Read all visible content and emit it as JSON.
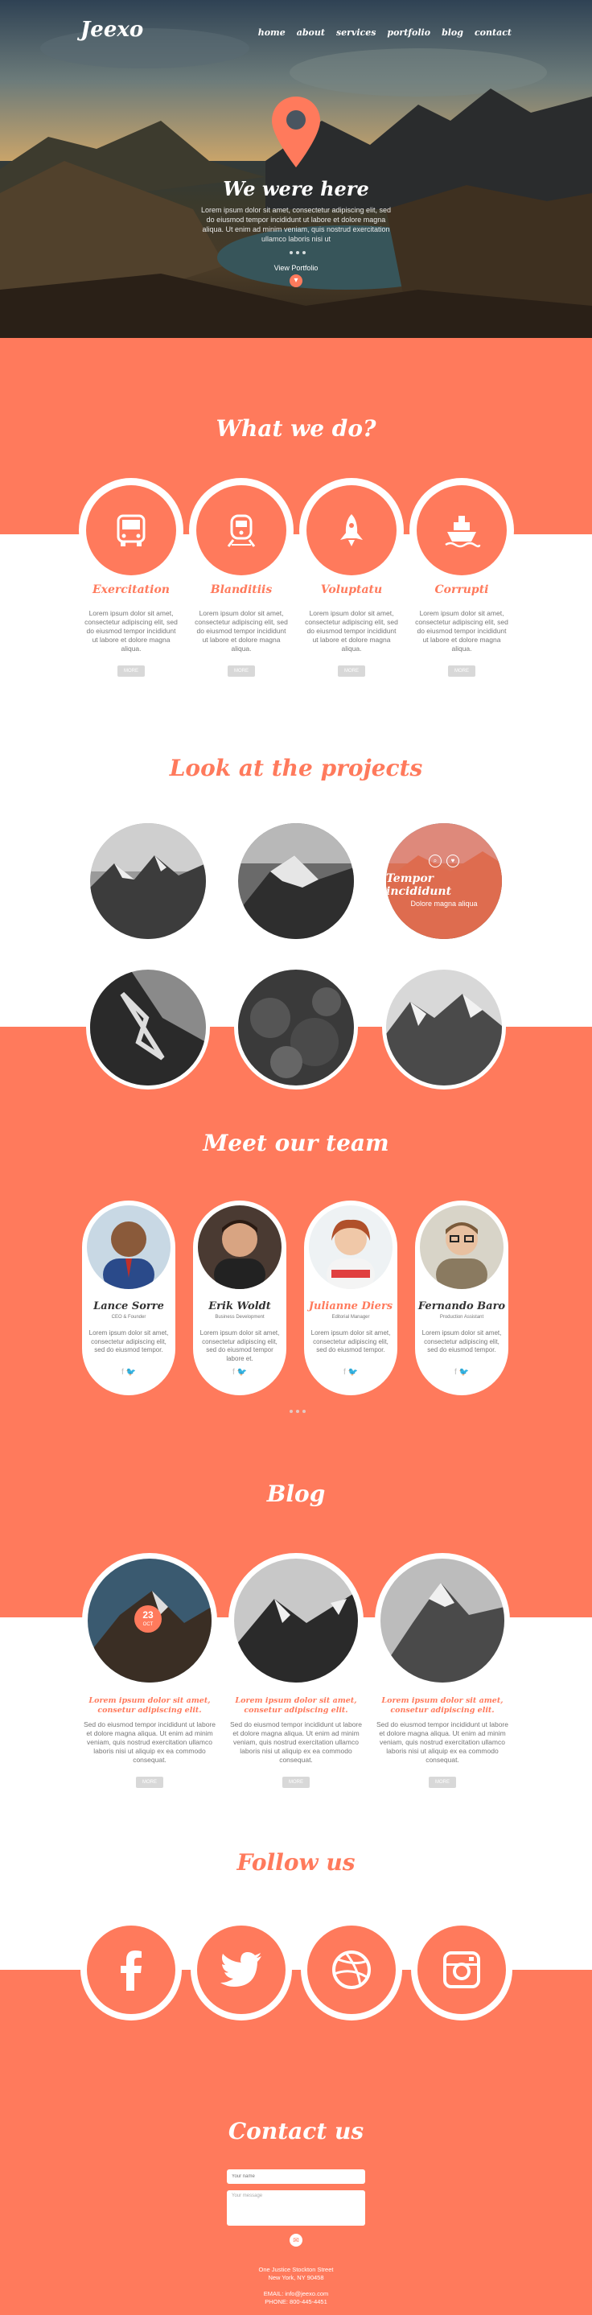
{
  "brand": {
    "logo": "Jeexo"
  },
  "nav": {
    "items": [
      "home",
      "about",
      "services",
      "portfolio",
      "blog",
      "contact"
    ]
  },
  "hero": {
    "title": "We were here",
    "text": "Lorem ipsum dolor sit amet, consectetur adipiscing elit, sed do eiusmod tempor incididunt ut labore et dolore magna aliqua. Ut enim ad minim veniam, quis nostrud exercitation ullamco laboris nisi ut",
    "link": "View Portfolio"
  },
  "services": {
    "title": "What we do?",
    "more_label": "MORE",
    "items": [
      {
        "icon": "bus-icon",
        "title": "Exercitation",
        "text": "Lorem ipsum dolor sit amet, consectetur adipiscing elit, sed do eiusmod tempor incididunt ut labore et dolore magna aliqua."
      },
      {
        "icon": "train-icon",
        "title": "Blanditiis",
        "text": "Lorem ipsum dolor sit amet, consectetur adipiscing elit, sed do eiusmod tempor incididunt ut labore et dolore magna aliqua."
      },
      {
        "icon": "rocket-icon",
        "title": "Voluptatu",
        "text": "Lorem ipsum dolor sit amet, consectetur adipiscing elit, sed do eiusmod tempor incididunt ut labore et dolore magna aliqua."
      },
      {
        "icon": "ship-icon",
        "title": "Corrupti",
        "text": "Lorem ipsum dolor sit amet, consectetur adipiscing elit, sed do eiusmod tempor incididunt ut labore et dolore magna aliqua."
      }
    ]
  },
  "projects": {
    "title": "Look at the projects",
    "overlay_title": "Tempor incididunt",
    "overlay_sub": "Dolore magna aliqua"
  },
  "team": {
    "title": "Meet our team",
    "members": [
      {
        "name": "Lance Sorre",
        "role": "CEO & Founder",
        "text": "Lorem ipsum dolor sit amet, consectetur adipiscing elit, sed do eiusmod tempor."
      },
      {
        "name": "Erik Woldt",
        "role": "Business Development",
        "text": "Lorem ipsum dolor sit amet, consectetur adipiscing elit, sed do eiusmod tempor labore et."
      },
      {
        "name": "Julianne Diers",
        "role": "Editorial Manager",
        "text": "Lorem ipsum dolor sit amet, consectetur adipiscing elit, sed do eiusmod tempor."
      },
      {
        "name": "Fernando Baro",
        "role": "Production Assistant",
        "text": "Lorem ipsum dolor sit amet, consectetur adipiscing elit, sed do eiusmod tempor."
      }
    ]
  },
  "blog": {
    "title": "Blog",
    "more_label": "MORE",
    "date_day": "23",
    "date_month": "OCT",
    "posts": [
      {
        "title": "Lorem ipsum dolor sit amet, consetur adipiscing elit.",
        "text": "Sed do eiusmod tempor incididunt ut labore et dolore magna aliqua. Ut enim ad minim veniam, quis nostrud exercitation ullamco laboris nisi ut aliquip ex ea commodo consequat."
      },
      {
        "title": "Lorem ipsum dolor sit amet, consetur adipiscing elit.",
        "text": "Sed do eiusmod tempor incididunt ut labore et dolore magna aliqua. Ut enim ad minim veniam, quis nostrud exercitation ullamco laboris nisi ut aliquip ex ea commodo consequat."
      },
      {
        "title": "Lorem ipsum dolor sit amet, consetur adipiscing elit.",
        "text": "Sed do eiusmod tempor incididunt ut labore et dolore magna aliqua. Ut enim ad minim veniam, quis nostrud exercitation ullamco laboris nisi ut aliquip ex ea commodo consequat."
      }
    ]
  },
  "follow": {
    "title": "Follow us",
    "icons": [
      "facebook-icon",
      "twitter-icon",
      "dribbble-icon",
      "instagram-icon"
    ]
  },
  "contact": {
    "title": "Contact us",
    "name_placeholder": "Your name",
    "message_placeholder": "Your message",
    "address1": "One Justice Stockton Street",
    "address2": "New York, NY 90458",
    "email": "EMAIL: info@jeexo.com",
    "phone": "PHONE: 800-445-4451"
  },
  "colors": {
    "accent": "#ff7a5c"
  }
}
